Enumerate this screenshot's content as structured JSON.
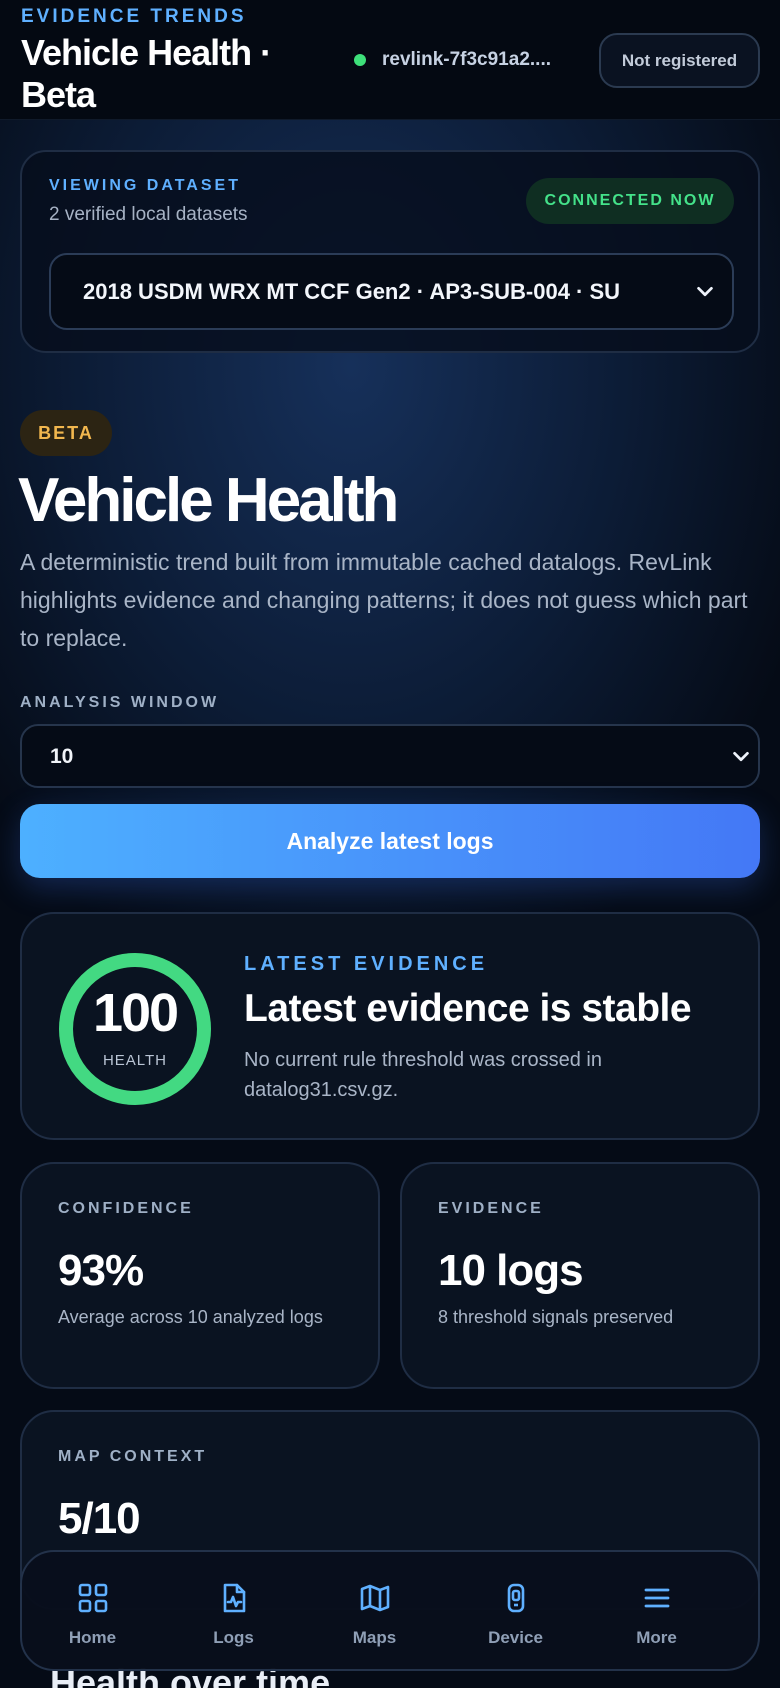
{
  "header": {
    "eyebrow": "EVIDENCE TRENDS",
    "title": "Vehicle Health · Beta",
    "device_id": "revlink-7f3c91a2....",
    "status_color": "#3ee07a",
    "register_label": "Not registered"
  },
  "dataset": {
    "eyebrow": "VIEWING DATASET",
    "subtitle": "2 verified local datasets",
    "connection_badge": "CONNECTED NOW",
    "selected": "2018 USDM WRX MT CCF Gen2 · AP3-SUB-004 · SU"
  },
  "page": {
    "badge": "BETA",
    "title": "Vehicle Health",
    "description": "A deterministic trend built from immutable cached datalogs. RevLink highlights evidence and changing patterns; it does not guess which part to replace.",
    "window_label": "ANALYSIS WINDOW",
    "window_value": "10",
    "analyze_label": "Analyze latest logs"
  },
  "evidence": {
    "health_score": "100",
    "health_fraction": 1.0,
    "health_label": "HEALTH",
    "eyebrow": "LATEST EVIDENCE",
    "title": "Latest evidence is stable",
    "text": "No current rule threshold was crossed in datalog31.csv.gz.",
    "ring_color": "#43d982"
  },
  "stats": {
    "confidence": {
      "label": "CONFIDENCE",
      "value": "93%",
      "sub": "Average across 10 analyzed logs"
    },
    "evidence": {
      "label": "EVIDENCE",
      "value": "10 logs",
      "sub": "8 threshold signals preserved"
    },
    "map": {
      "label": "MAP CONTEXT",
      "value": "5/10"
    }
  },
  "section_heading": "Health over time",
  "nav": {
    "items": [
      {
        "label": "Home",
        "icon": "home-grid-icon"
      },
      {
        "label": "Logs",
        "icon": "logs-file-icon"
      },
      {
        "label": "Maps",
        "icon": "map-icon"
      },
      {
        "label": "Device",
        "icon": "device-icon"
      },
      {
        "label": "More",
        "icon": "menu-icon"
      }
    ]
  },
  "colors": {
    "accent": "#5fb0ff",
    "success": "#44e28a",
    "warning": "#f2b74e",
    "button_gradient_start": "#4db0ff",
    "button_gradient_end": "#4478f6"
  }
}
